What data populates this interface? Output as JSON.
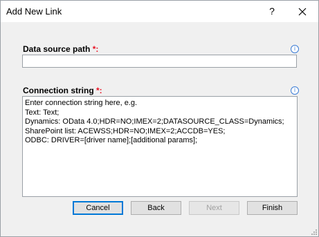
{
  "window": {
    "title": "Add New Link",
    "help_glyph": "?",
    "close_glyph": "✕"
  },
  "data_source": {
    "label": "Data source path",
    "required_mark": "*:",
    "value": ""
  },
  "connection": {
    "label": "Connection string",
    "required_mark": "*:",
    "lines": [
      "Enter connection string here, e.g.",
      "Text: Text;",
      "Dynamics: OData 4.0;HDR=NO;IMEX=2;DATASOURCE_CLASS=Dynamics;",
      "SharePoint list: ACEWSS;HDR=NO;IMEX=2;ACCDB=YES;",
      "ODBC: DRIVER=[driver name];[additional params];"
    ]
  },
  "buttons": {
    "cancel_label": "Cancel",
    "back_label": "Back",
    "next_label": "Next",
    "finish_label": "Finish"
  },
  "icons": {
    "info_icon": "i",
    "required_color": "#e81123",
    "info_color": "#3a7bd5",
    "default_button_color": "#0078d7"
  }
}
